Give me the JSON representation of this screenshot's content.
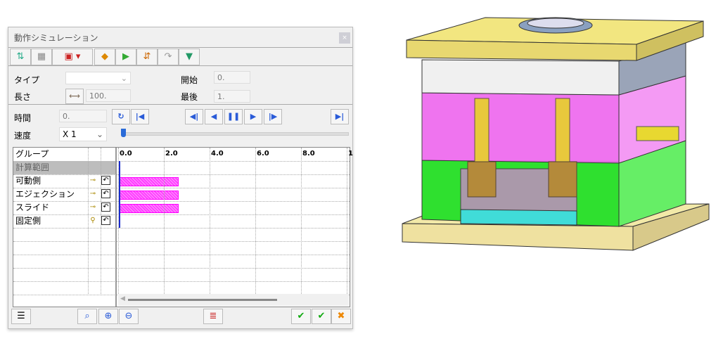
{
  "dialog": {
    "title": "動作シミュレーション",
    "close": "×"
  },
  "form": {
    "type_label": "タイプ",
    "type_value": "",
    "length_label": "長さ",
    "length_value": "100.",
    "start_label": "開始",
    "start_value": "0.",
    "end_label": "最後",
    "end_value": "1.",
    "time_label": "時間",
    "time_value": "0.",
    "speed_label": "速度",
    "speed_value": "X 1",
    "speed_slider": 0
  },
  "grid": {
    "header": "グループ",
    "ticks": [
      "0.0",
      "2.0",
      "4.0",
      "6.0",
      "8.0",
      "1"
    ],
    "rows": [
      {
        "name": "計算範囲",
        "bar": null
      },
      {
        "name": "可動側",
        "bar": [
          0,
          2.55
        ]
      },
      {
        "name": "エジェクション",
        "bar": [
          0,
          2.55
        ]
      },
      {
        "name": "スライド",
        "bar": [
          0,
          2.55
        ]
      },
      {
        "name": "固定側",
        "bar": null
      }
    ]
  },
  "colors": {
    "bar": "#ff00ff",
    "accent": "#2a5bd8"
  }
}
